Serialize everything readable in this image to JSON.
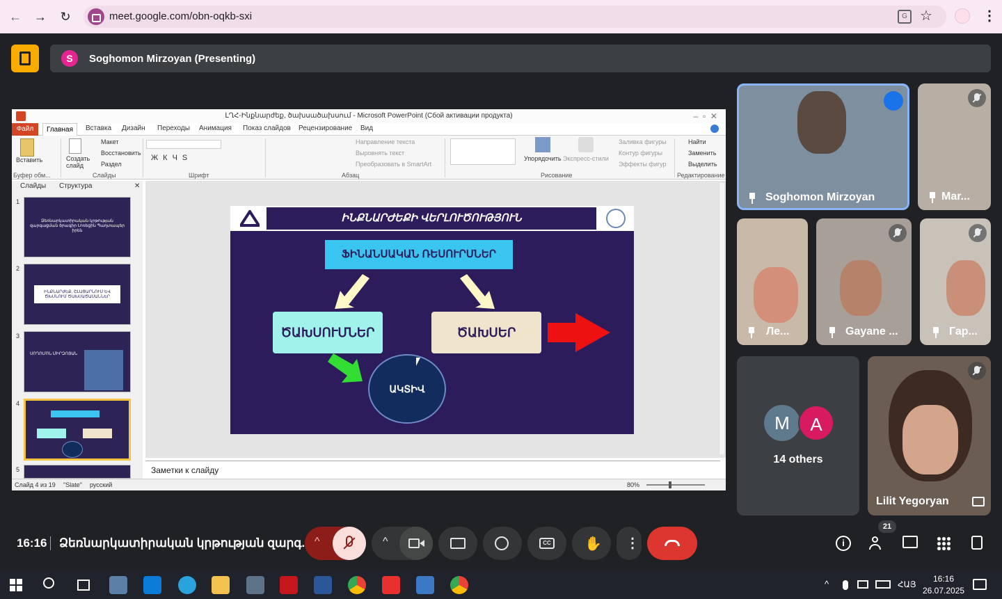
{
  "browser": {
    "url": "meet.google.com/obn-oqkb-sxi",
    "back_icon": "arrow-left",
    "forward_icon": "arrow-right",
    "reload_icon": "reload"
  },
  "meeting": {
    "presenter_initial": "S",
    "presenting_label": "Soghomon Mirzoyan (Presenting)",
    "time": "16:16",
    "title": "Ձեռնարկատիրական կրթության զարգ...",
    "participant_count": "21"
  },
  "ppt": {
    "window_title": "ԼՂՀ-Ինքնարժեք, ծախսածախսում - Microsoft PowerPoint (Сбой активации продукта)",
    "tabs": [
      "Файл",
      "Главная",
      "Вставка",
      "Дизайн",
      "Переходы",
      "Анимация",
      "Показ слайдов",
      "Рецензирование",
      "Вид"
    ],
    "ribbon": {
      "paste": "Вставить",
      "clipboard": "Буфер обм...",
      "create_slide": "Создать слайд",
      "layout": "Макет",
      "restore": "Восстановить",
      "section": "Раздел",
      "slides_group": "Слайды",
      "font_group": "Шрифт",
      "text_direction": "Направление текста",
      "align_text": "Выровнять текст",
      "convert_smartart": "Преобразовать в SmartArt",
      "paragraph_group": "Абзац",
      "arrange": "Упорядочить",
      "quick_styles": "Экспресс-стили",
      "shape_fill": "Заливка фигуры",
      "shape_outline": "Контур фигуры",
      "shape_effects": "Эффекты фигур",
      "drawing_group": "Рисование",
      "find": "Найти",
      "replace": "Заменить",
      "select": "Выделить",
      "editing_group": "Редактирование"
    },
    "panel_tabs": [
      "Слайды",
      "Структура"
    ],
    "thumbs": [
      {
        "num": "1",
        "text": "Ձեռնարկատիրական կրթության զարգացման ծրագիր Լոռեցին Պաղտապեր իրեն"
      },
      {
        "num": "2",
        "text": "ԻՆՔՆԱՐԺԵՔ, ՇԼԱՑԱՐՆՈՒՄ ԵՎ ԾԽՍՆՈՒՄ ԾԱԽՍԱԾԱՍԱՆՆԵՐ"
      },
      {
        "num": "3",
        "text": "ՍՈՂՈՄՈՆ ՄԻՐԶՈՅԱՆ"
      },
      {
        "num": "4",
        "text": ""
      },
      {
        "num": "5",
        "text": ""
      }
    ],
    "notes": "Заметки к слайду",
    "status_slide": "Слайд 4 из 19",
    "status_theme": "\"Slate\"",
    "status_lang": "русский",
    "zoom": "80%",
    "slide": {
      "title": "ԻՆՔՆԱՐԺԵՔԻ ՎԵՐԼՈՒԾՈՒԹՅՈՒՆ",
      "banner": "ՖԻՆԱՆՍԱԿԱՆ ՌԵՍՈՒՐՍՆԵՐ",
      "left_box": "ԾԱԽՍՈՒՄՆԵՐ",
      "right_box": "ԾԱԽՍԵՐ",
      "circle": "ԱԿՏԻՎ"
    }
  },
  "tiles": [
    {
      "name": "Soghomon Mirzoyan"
    },
    {
      "name": "Mar..."
    },
    {
      "name": "Ле..."
    },
    {
      "name": "Gayane ..."
    },
    {
      "name": "Гар..."
    },
    {
      "name": "Lilit Yegoryan"
    }
  ],
  "others": {
    "initials": [
      "M",
      "A"
    ],
    "label": "14 others"
  },
  "taskbar": {
    "lang": "ՀԱՅ",
    "time": "16:16",
    "date": "26.07.2025"
  },
  "colors": {
    "meet_bg": "#202124",
    "tile_bg": "#3c4043",
    "end_call": "#ea4335",
    "accent_blue": "#8ab4f8"
  }
}
